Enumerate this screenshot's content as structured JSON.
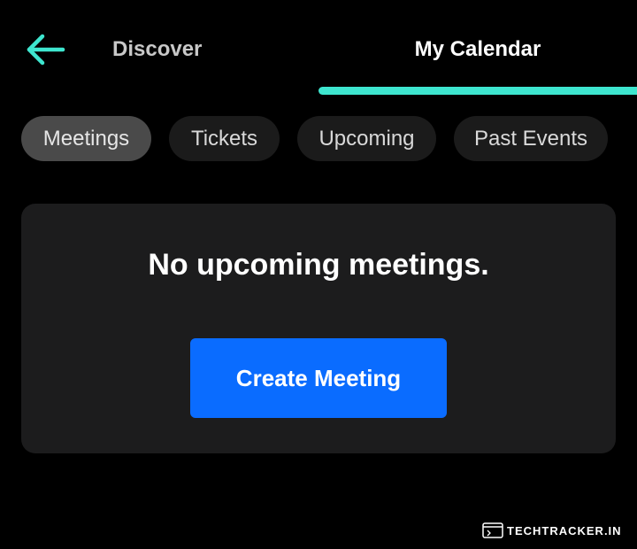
{
  "header": {
    "back_icon": "arrow-left-icon",
    "tabs": [
      {
        "label": "Discover",
        "active": false
      },
      {
        "label": "My Calendar",
        "active": true
      }
    ]
  },
  "filters": {
    "chips": [
      {
        "label": "Meetings",
        "active": true
      },
      {
        "label": "Tickets",
        "active": false
      },
      {
        "label": "Upcoming",
        "active": false
      },
      {
        "label": "Past Events",
        "active": false
      }
    ]
  },
  "empty_state": {
    "message": "No upcoming meetings.",
    "button_label": "Create Meeting"
  },
  "watermark": {
    "text": "TECHTRACKER.IN"
  },
  "colors": {
    "background": "#000000",
    "accent": "#3ee6cf",
    "primary_button": "#0a6cff",
    "card": "#1c1c1d",
    "chip_active": "#4a4a4a",
    "chip_inactive": "#1b1b1b"
  }
}
